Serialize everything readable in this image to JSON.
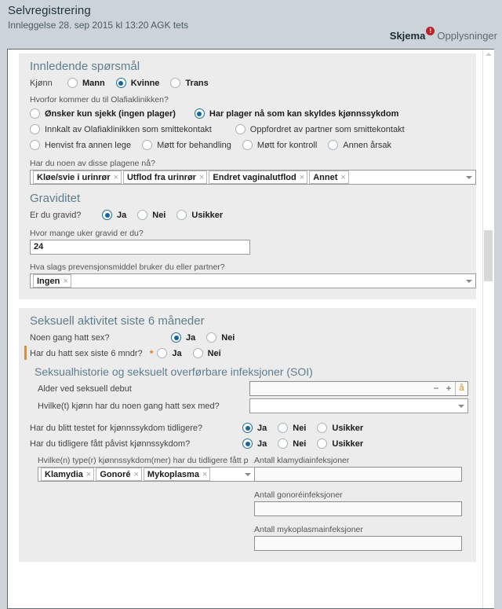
{
  "header": {
    "title": "Selvregistrering",
    "subtitle": "Innleggelse 28. sep 2015 kl 13:20 AGK tets",
    "tabs": [
      {
        "label": "Skjema",
        "active": true,
        "badge": "!",
        "badge_type": "error",
        "badge_color": "#c02026"
      },
      {
        "label": "Opplysninger",
        "active": false,
        "badge": "⚠",
        "badge_type": "warning",
        "badge_color": "#e9a900"
      }
    ]
  },
  "colors": {
    "header_bg": "#ccd4d9",
    "panel_bg": "#ececec",
    "section_heading": "#5f7d8e",
    "radio_accent": "#1565a0",
    "required_orange": "#f08a1d",
    "error_red": "#c02026",
    "warning_yellow": "#e9a900"
  },
  "sections": [
    {
      "id": "innledende",
      "title": "Innledende spørsmål",
      "gender": {
        "label": "Kjønn",
        "options": [
          "Mann",
          "Kvinne",
          "Trans"
        ],
        "selected": "Kvinne"
      },
      "reason": {
        "label": "Hvorfor kommer du til Olafiaklinikken?",
        "rows": [
          [
            "Ønsker kun sjekk (ingen plager)",
            "Har plager nå som kan skyldes kjønnssykdom"
          ],
          [
            "Innkalt av Olafiaklinikken som smittekontakt",
            "Oppfordret av partner som smittekontakt"
          ],
          [
            "Henvist fra annen lege",
            "Møtt for behandling",
            "Møtt for kontroll",
            "Annen årsak"
          ]
        ],
        "selected": "Har plager nå som kan skyldes kjønnssykdom"
      },
      "symptoms": {
        "label": "Har du noen av disse plagene nå?",
        "chips": [
          "Kløe/svie i urinrør",
          "Utflod fra urinrør",
          "Endret vaginalutflod",
          "Annet"
        ],
        "remove_glyph": "×"
      },
      "graviditet": {
        "title": "Graviditet",
        "pregnant": {
          "label": "Er du gravid?",
          "options": [
            "Ja",
            "Nei",
            "Usikker"
          ],
          "selected": "Ja"
        },
        "weeks": {
          "label": "Hvor mange uker gravid er du?",
          "value": "24"
        },
        "contraception": {
          "label": "Hva slags prevensjonsmiddel bruker du eller partner?",
          "chips": [
            "Ingen"
          ]
        }
      }
    },
    {
      "id": "seksuell-aktivitet",
      "title": "Seksuell aktivitet siste 6 måneder",
      "ever_sex": {
        "label": "Noen gang hatt sex?",
        "options": [
          "Ja",
          "Nei"
        ],
        "selected": "Ja"
      },
      "sex_last_6": {
        "label": "Har du hatt sex siste 6 mndr?",
        "required_marker": "*",
        "options": [
          "Ja",
          "Nei"
        ],
        "selected": ""
      },
      "soi": {
        "title": "Seksualhistorie og seksuelt overførbare infeksjoner (SOI)",
        "debut_age": {
          "label": "Alder ved seksuell debut",
          "value": "",
          "minus": "−",
          "plus": "+",
          "unit": "å"
        },
        "partner_genders": {
          "label": "Hvilke(t) kjønn har du noen gang hatt sex med?",
          "value": ""
        },
        "tested_before": {
          "label": "Har du blitt testet for kjønnssykdom tidligere?",
          "options": [
            "Ja",
            "Nei",
            "Usikker"
          ],
          "selected": "Ja"
        },
        "diagnosed_before": {
          "label": "Har du tidligere fått påvist kjønnssykdom?",
          "options": [
            "Ja",
            "Nei",
            "Usikker"
          ],
          "selected": "Ja"
        },
        "sti_types": {
          "label": "Hvilke(n) type(r) kjønnssykdom(mer) har du tidligere fått p",
          "chips": [
            "Klamydia",
            "Gonoré",
            "Mykoplasma"
          ]
        },
        "counts": [
          {
            "label": "Antall klamydiainfeksjoner",
            "value": ""
          },
          {
            "label": "Antall gonoréinfeksjoner",
            "value": ""
          },
          {
            "label": "Antall mykoplasmainfeksjoner",
            "value": ""
          }
        ]
      }
    }
  ]
}
